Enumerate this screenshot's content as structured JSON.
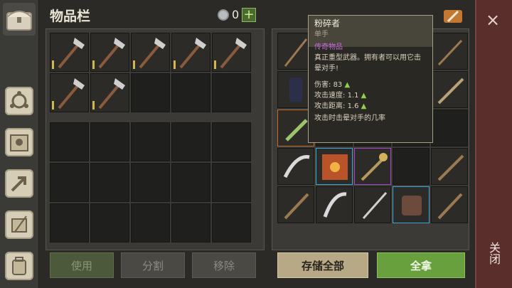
{
  "header": {
    "title": "物品栏",
    "coin_count": "0",
    "plus": "+"
  },
  "buttons": {
    "use": "使用",
    "split": "分割",
    "remove": "移除",
    "store_all": "存储全部",
    "take_all": "全拿"
  },
  "close": {
    "label": "关闭",
    "x": "×"
  },
  "tooltip": {
    "name": "粉碎者",
    "subtype": "单手",
    "rarity": "传奇物品",
    "description": "真正重型武器。拥有者可以用它击晕对手!",
    "stats": [
      {
        "label": "伤害:",
        "value": "83",
        "arrow": "▲"
      },
      {
        "label": "攻击速度:",
        "value": "1.1",
        "arrow": "▲"
      },
      {
        "label": "攻击距离:",
        "value": "1.6",
        "arrow": "▲"
      }
    ],
    "effect": "攻击时击晕对手的几率"
  },
  "colors": {
    "rarity_purple": "#c56bde",
    "stat_up": "#8fd14f",
    "take_green": "#69a03e",
    "close_red": "#5a2e2a"
  },
  "nav_icons": [
    "chest-icon",
    "compass-icon",
    "sun-book-icon",
    "craft-arrow-icon",
    "scroll-quill-icon",
    "backpack-icon"
  ]
}
